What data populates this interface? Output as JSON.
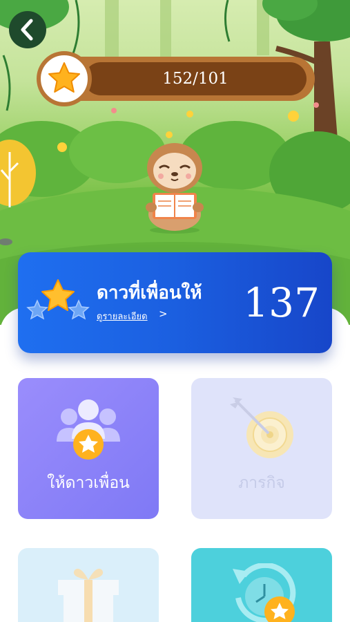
{
  "progress": {
    "text": "152/101"
  },
  "banner": {
    "title": "ดาวที่เพื่อนให้",
    "link": "ดูรายละเอียด",
    "arrow": ">",
    "count": "137"
  },
  "tiles": [
    {
      "label": "ให้ดาวเพื่อน",
      "icon": "friends-star-icon"
    },
    {
      "label": "ภารกิจ",
      "icon": "target-icon"
    },
    {
      "label": "",
      "icon": "gift-icon"
    },
    {
      "label": "",
      "icon": "history-star-icon"
    }
  ],
  "colors": {
    "banner_blue": "#1f6ff0",
    "star_gold": "#ffb21e",
    "progress_brown": "#7a4216",
    "tile_purple": "#8c84f8",
    "tile_teal": "#4dd0dc"
  }
}
